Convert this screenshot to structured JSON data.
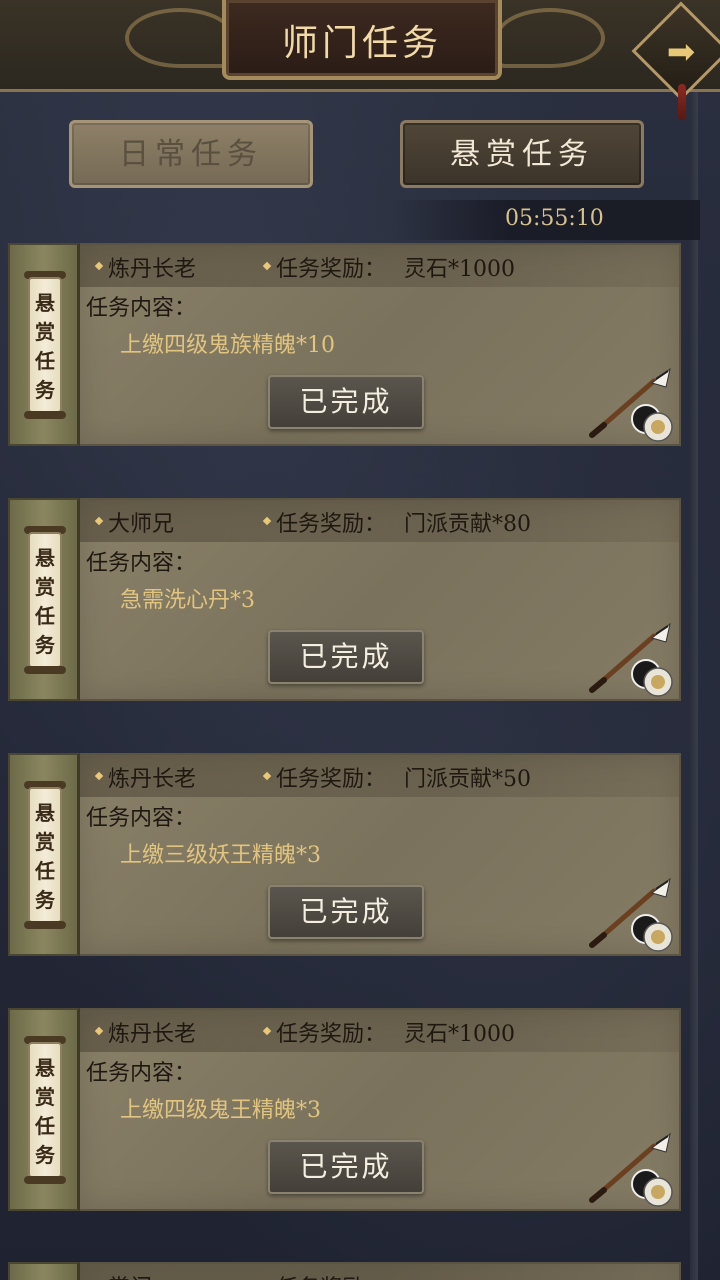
{
  "header": {
    "title": "师门任务"
  },
  "tabs": [
    {
      "label": "日常任务",
      "active": false
    },
    {
      "label": "悬赏任务",
      "active": true
    }
  ],
  "timer": "05:55:10",
  "tag_text": "悬赏任务",
  "tasks": [
    {
      "issuer": "炼丹长老",
      "reward_label": "任务奖励：",
      "reward": "灵石*1000",
      "content_label": "任务内容：",
      "content": "上缴四级鬼族精魄*10",
      "status": "已完成"
    },
    {
      "issuer": "大师兄",
      "reward_label": "任务奖励：",
      "reward": "门派贡献*80",
      "content_label": "任务内容：",
      "content": "急需洗心丹*3",
      "status": "已完成"
    },
    {
      "issuer": "炼丹长老",
      "reward_label": "任务奖励：",
      "reward": "门派贡献*50",
      "content_label": "任务内容：",
      "content": "上缴三级妖王精魄*3",
      "status": "已完成"
    },
    {
      "issuer": "炼丹长老",
      "reward_label": "任务奖励：",
      "reward": "灵石*1000",
      "content_label": "任务内容：",
      "content": "上缴四级鬼王精魄*3",
      "status": "已完成"
    }
  ],
  "partial_task": {
    "issuer": "掌门",
    "reward_label": "任务奖励："
  },
  "colors": {
    "accent_gold": "#e0c480",
    "title_gold": "#f1d9a8",
    "card_bg": "#847b64"
  },
  "icons": {
    "next": "arrow-right-icon",
    "brush": "brush-icon"
  }
}
